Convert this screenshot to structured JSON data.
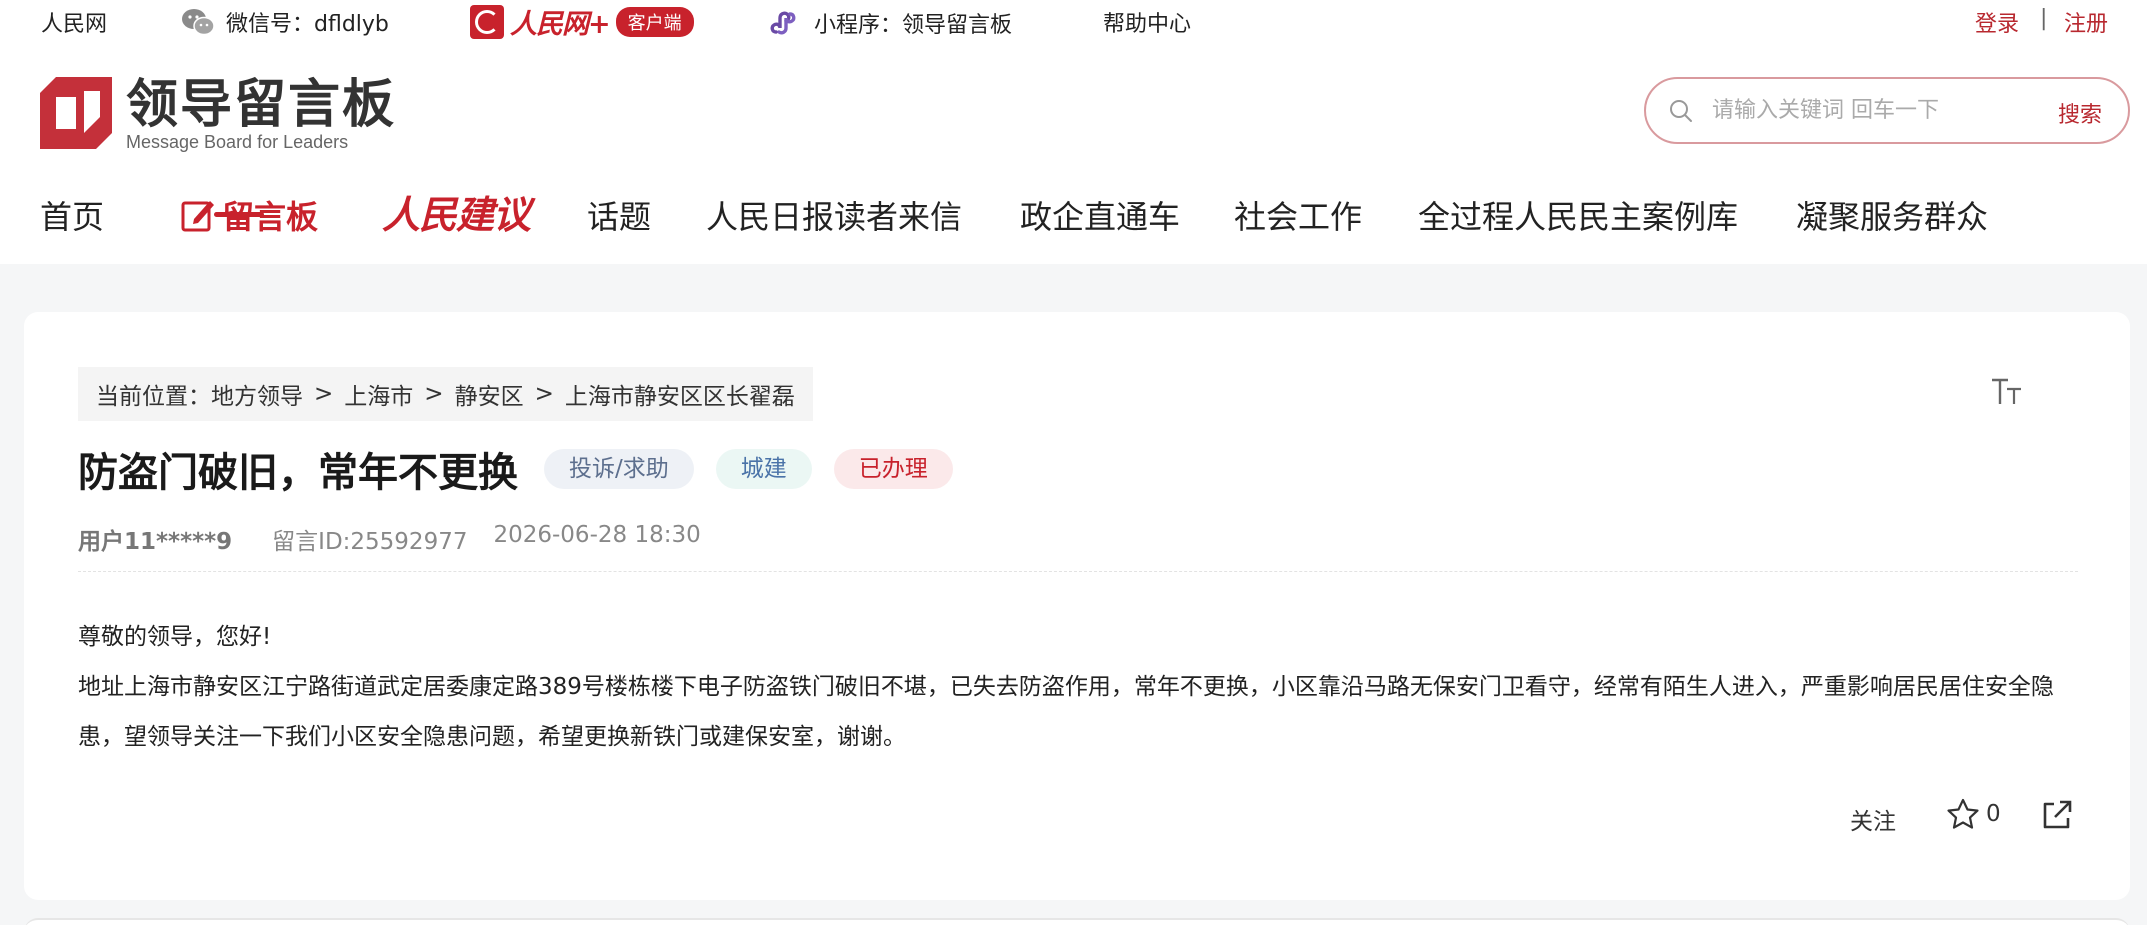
{
  "topbar": {
    "site": "人民网",
    "wechat": "微信号：dfldlyb",
    "client_brand": "人民网+",
    "client_pill": "客户端",
    "miniprogram": "小程序：领导留言板",
    "help": "帮助中心",
    "login": "登录",
    "separator": "|",
    "register": "注册"
  },
  "logo": {
    "title": "领导留言板",
    "subtitle": "Message Board for Leaders"
  },
  "search": {
    "placeholder": "请输入关键词 回车一下",
    "button": "搜索"
  },
  "nav": {
    "home": "首页",
    "board": "留言板",
    "suggest": "人民建议",
    "topics": "话题",
    "letters": "人民日报读者来信",
    "enterprise": "政企直通车",
    "social": "社会工作",
    "democracy": "全过程人民民主案例库",
    "serve": "凝聚服务群众"
  },
  "breadcrumb": {
    "prefix": "当前位置：",
    "items": [
      "地方领导",
      "上海市",
      "静安区",
      "上海市静安区区长翟磊"
    ],
    "separator": ">"
  },
  "font_size_glyph": "TT",
  "post": {
    "title": "防盗门破旧，常年不更换",
    "tags": {
      "type": "投诉/求助",
      "category": "城建",
      "status": "已办理"
    },
    "user": "用户11*****9",
    "message_id": "留言ID:25592977",
    "datetime": "2026-06-28 18:30",
    "greeting": "尊敬的领导，您好!",
    "content": "地址上海市静安区江宁路街道武定居委康定路389号楼栋楼下电子防盗铁门破旧不堪，已失去防盗作用，常年不更换，小区靠沿马路无保安门卫看守，经常有陌生人进入，严重影响居民居住安全隐患，望领导关注一下我们小区安全隐患问题，希望更换新铁门或建保安室，谢谢。"
  },
  "actions": {
    "follow": "关注",
    "star_count": "0"
  },
  "colors": {
    "brand_red": "#c8222c",
    "tag_type_bg": "#eef1f6",
    "tag_cat_bg": "#ebf7f4",
    "tag_status_bg": "#fbe9ea"
  }
}
